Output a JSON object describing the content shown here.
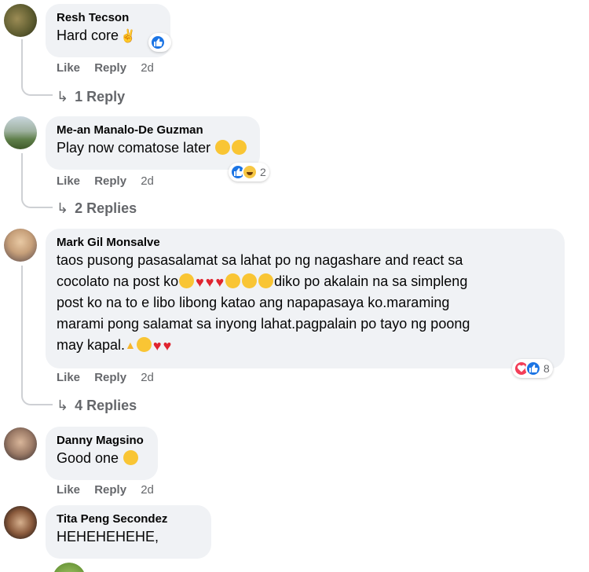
{
  "action_labels": {
    "like": "Like",
    "reply": "Reply"
  },
  "comments": [
    {
      "author": "Resh Tecson",
      "text": "Hard core",
      "time": "2d",
      "reactions": {
        "count": ""
      },
      "replies": "1 Reply"
    },
    {
      "author": "Me-an Manalo-De Guzman",
      "text": "Play now comatose later",
      "time": "2d",
      "reactions": {
        "count": "2"
      },
      "replies": "2 Replies"
    },
    {
      "author": "Mark Gil Monsalve",
      "text_parts": [
        "taos pusong pasasalamat sa lahat po ng nagashare and react sa",
        "cocolato na post ko",
        "diko po akalain na sa simpleng",
        "post ko na to e libo libong katao ang napapasaya ko.maraming",
        "marami pong salamat sa inyong lahat.pagpalain po tayo ng poong",
        "may kapal."
      ],
      "time": "2d",
      "reactions": {
        "count": "8"
      },
      "replies": "4 Replies"
    },
    {
      "author": "Danny Magsino",
      "text": "Good one",
      "time": "2d"
    },
    {
      "author": "Tita Peng Secondez",
      "text": "HEHEHEHEHE,"
    }
  ],
  "colors": {
    "bubble": "#f0f2f5",
    "meta_text": "#65676b",
    "like_blue": "#1b74e4",
    "love_red": "#f33e58",
    "haha_yellow": "#f7c744"
  },
  "icons": [
    "like-reaction-icon",
    "haha-reaction-icon",
    "love-reaction-icon",
    "heart-eyes-emoji-icon",
    "heart-emoji-icon",
    "kiss-emoji-icon",
    "pray-emoji-icon",
    "laugh-emoji-icon",
    "peace-hand-emoji-icon",
    "reply-arrow-icon"
  ]
}
